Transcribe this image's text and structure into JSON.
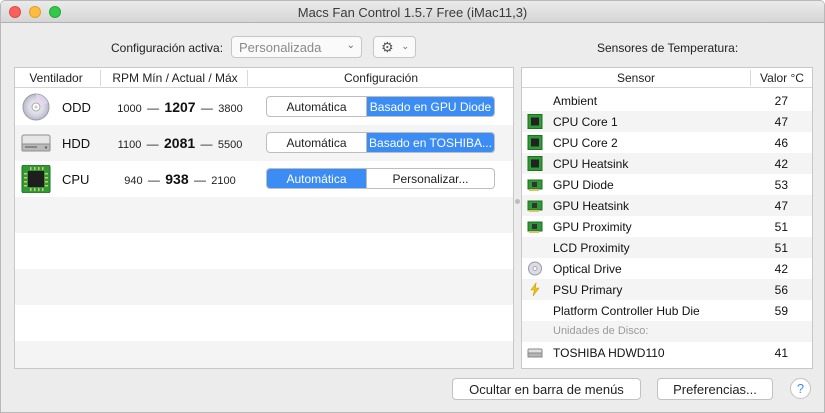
{
  "window": {
    "title": "Macs Fan Control 1.5.7 Free (iMac11,3)"
  },
  "toolbar": {
    "config_label": "Configuración activa:",
    "preset_value": "Personalizada",
    "gear_icon": "gear-icon",
    "sensors_title": "Sensores de Temperatura:"
  },
  "fans": {
    "headers": {
      "fan": "Ventilador",
      "rpm": "RPM Mín / Actual / Máx",
      "config": "Configuración"
    },
    "rows": [
      {
        "name": "ODD",
        "icon": "optical-disc-icon",
        "min": "1000",
        "current": "1207",
        "max": "3800",
        "left_option": "Automática",
        "right_option": "Basado en GPU Diode",
        "selected": "right"
      },
      {
        "name": "HDD",
        "icon": "hard-drive-icon",
        "min": "1100",
        "current": "2081",
        "max": "5500",
        "left_option": "Automática",
        "right_option": "Basado en TOSHIBA...",
        "selected": "right"
      },
      {
        "name": "CPU",
        "icon": "cpu-chip-icon",
        "min": "940",
        "current": "938",
        "max": "2100",
        "left_option": "Automática",
        "right_option": "Personalizar...",
        "selected": "left"
      }
    ]
  },
  "sensors": {
    "headers": {
      "sensor": "Sensor",
      "value": "Valor °C"
    },
    "rows": [
      {
        "name": "Ambient",
        "value": "27",
        "icon": ""
      },
      {
        "name": "CPU Core 1",
        "value": "47",
        "icon": "cpu-chip-icon"
      },
      {
        "name": "CPU Core 2",
        "value": "46",
        "icon": "cpu-chip-icon"
      },
      {
        "name": "CPU Heatsink",
        "value": "42",
        "icon": "cpu-chip-icon"
      },
      {
        "name": "GPU Diode",
        "value": "53",
        "icon": "gpu-card-icon"
      },
      {
        "name": "GPU Heatsink",
        "value": "47",
        "icon": "gpu-card-icon"
      },
      {
        "name": "GPU Proximity",
        "value": "51",
        "icon": "gpu-card-icon"
      },
      {
        "name": "LCD Proximity",
        "value": "51",
        "icon": ""
      },
      {
        "name": "Optical Drive",
        "value": "42",
        "icon": "optical-disc-icon"
      },
      {
        "name": "PSU Primary",
        "value": "56",
        "icon": "lightning-icon"
      },
      {
        "name": "Platform Controller Hub Die",
        "value": "59",
        "icon": ""
      }
    ],
    "disk_section_label": "Unidades de Disco:",
    "disk_rows": [
      {
        "name": "TOSHIBA HDWD110",
        "value": "41",
        "icon": "hard-drive-icon"
      }
    ]
  },
  "footer": {
    "hide_button": "Ocultar en barra de menús",
    "prefs_button": "Preferencias...",
    "help_button": "?"
  },
  "colors": {
    "accent": "#3b8cf5",
    "chip_green": "#3aa53a"
  }
}
